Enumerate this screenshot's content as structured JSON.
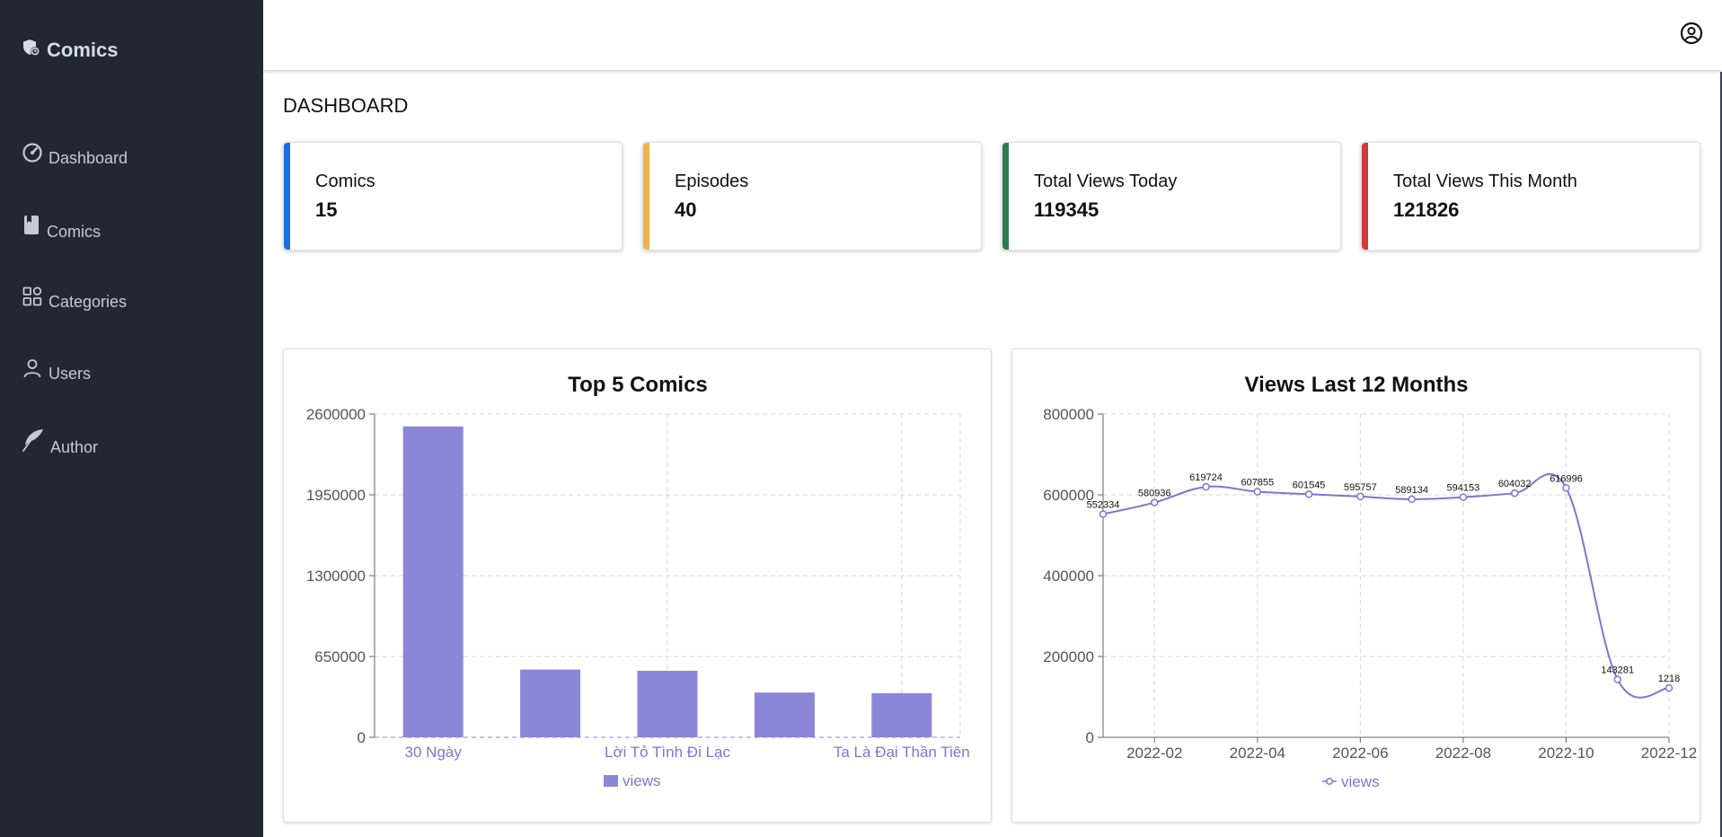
{
  "app": {
    "brand": "Comics"
  },
  "sidebar": {
    "items": [
      {
        "label": "Dashboard",
        "icon": "dashboard-icon"
      },
      {
        "label": "Comics",
        "icon": "book-icon"
      },
      {
        "label": "Categories",
        "icon": "categories-icon"
      },
      {
        "label": "Users",
        "icon": "user-icon"
      },
      {
        "label": "Author",
        "icon": "feather-icon"
      }
    ]
  },
  "header": {
    "account_icon": "account-circle-icon"
  },
  "page": {
    "title": "DASHBOARD"
  },
  "stats": [
    {
      "title": "Comics",
      "value": "15",
      "color": "#1a6fe0"
    },
    {
      "title": "Episodes",
      "value": "40",
      "color": "#f0b04b"
    },
    {
      "title": "Total Views Today",
      "value": "119345",
      "color": "#2f7a4e"
    },
    {
      "title": "Total Views This Month",
      "value": "121826",
      "color": "#d03c3c"
    }
  ],
  "chart_data": [
    {
      "type": "bar",
      "title": "Top 5 Comics",
      "categories": [
        "30 Ngày",
        "",
        "Lời Tỏ Tình Đi Lạc",
        "",
        "Ta Là Đại Thần Tiên"
      ],
      "series": [
        {
          "name": "views",
          "values": [
            2500000,
            545000,
            535000,
            360000,
            355000
          ]
        }
      ],
      "yticks": [
        "0",
        "650000",
        "1300000",
        "1950000",
        "2600000"
      ],
      "ylim": [
        0,
        2600000
      ],
      "legend": "bottom-center",
      "grid": true,
      "color": "#8a87d8"
    },
    {
      "type": "line",
      "title": "Views Last 12 Months",
      "x": [
        "2022-01",
        "2022-02",
        "2022-03",
        "2022-04",
        "2022-05",
        "2022-06",
        "2022-07",
        "2022-08",
        "2022-09",
        "2022-10",
        "2022-11",
        "2022-12"
      ],
      "xticks": [
        "2022-02",
        "2022-04",
        "2022-06",
        "2022-08",
        "2022-10",
        "2022-12"
      ],
      "series": [
        {
          "name": "views",
          "values": [
            552334,
            580936,
            619724,
            607855,
            601545,
            595757,
            589134,
            594153,
            604032,
            616996,
            143281,
            121826
          ]
        }
      ],
      "point_labels": [
        "552334",
        "580936",
        "619724",
        "607855",
        "601545",
        "595757",
        "589134",
        "594153",
        "604032",
        "616996",
        "143281",
        "1218"
      ],
      "yticks": [
        "0",
        "200000",
        "400000",
        "600000",
        "800000"
      ],
      "ylim": [
        0,
        800000
      ],
      "legend": "bottom-center",
      "grid": true,
      "color": "#7b77d1"
    }
  ]
}
